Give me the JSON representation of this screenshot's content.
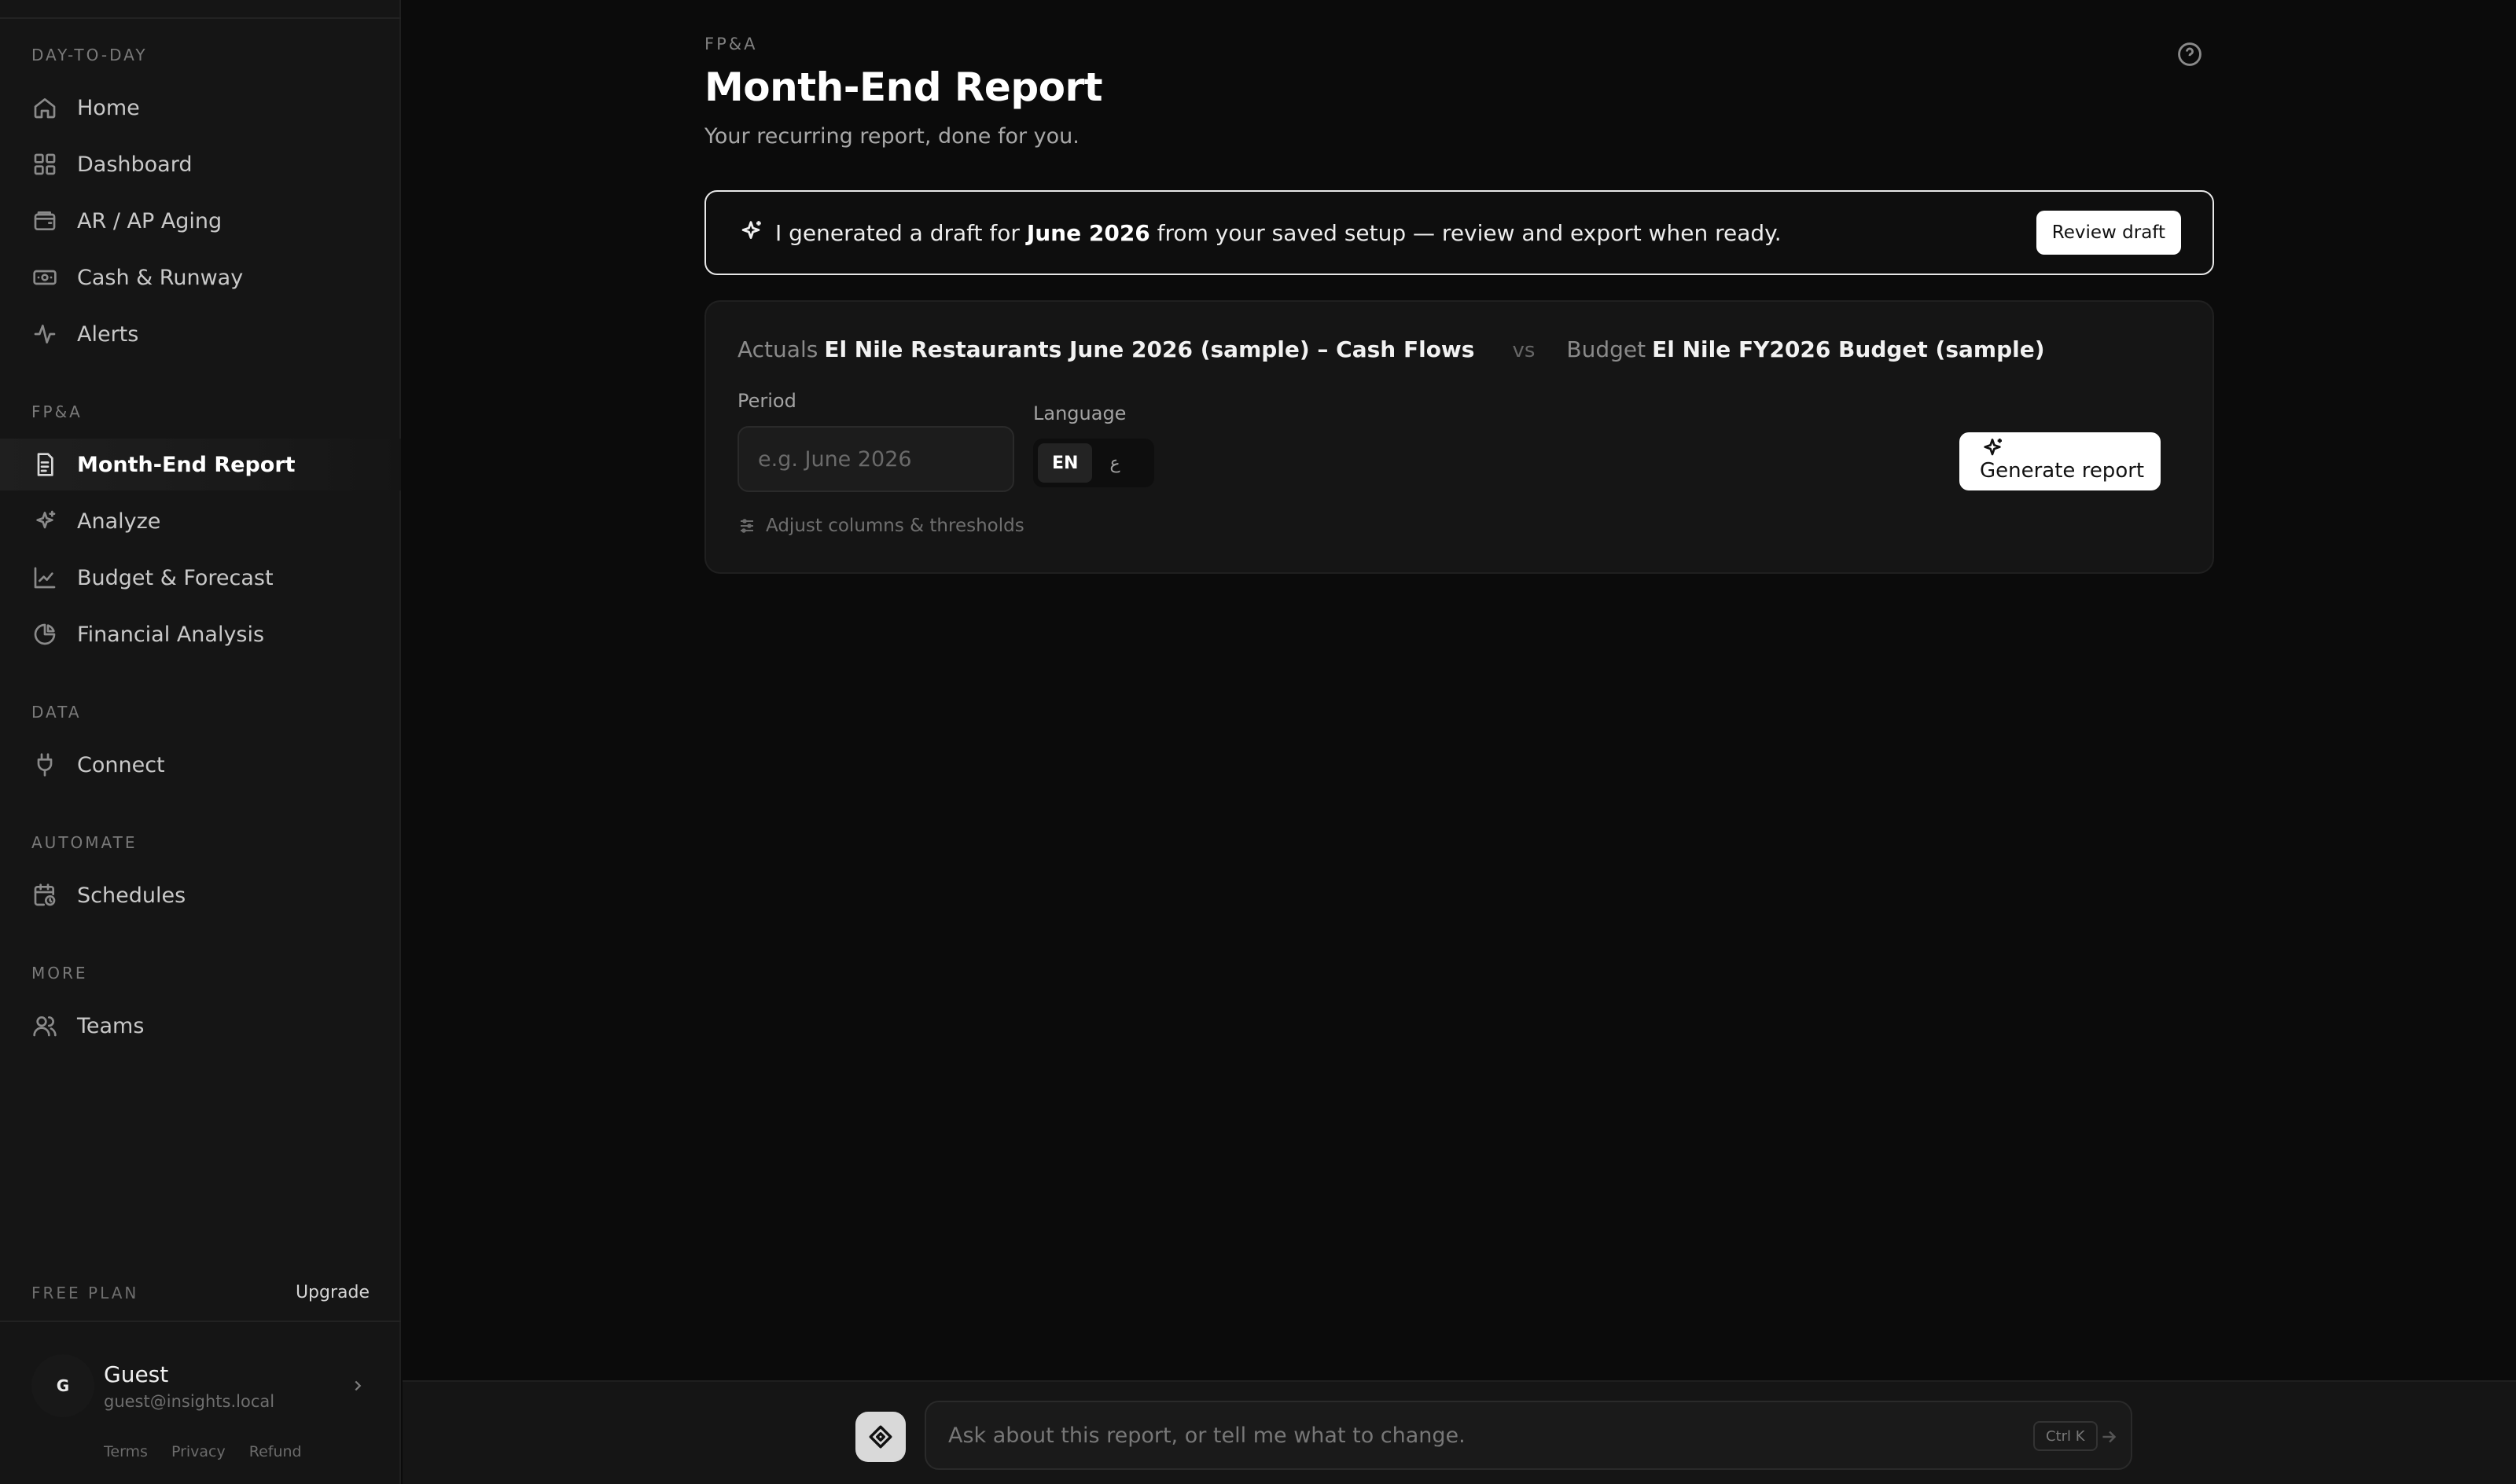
{
  "sidebar": {
    "sections": {
      "day_to_day": "DAY-TO-DAY",
      "fpa": "FP&A",
      "data": "DATA",
      "automate": "AUTOMATE",
      "more": "MORE"
    },
    "items": {
      "home": "Home",
      "dashboard": "Dashboard",
      "aging": "AR / AP Aging",
      "cash": "Cash & Runway",
      "alerts": "Alerts",
      "month_end": "Month-End Report",
      "analyze": "Analyze",
      "budget": "Budget & Forecast",
      "financial": "Financial Analysis",
      "connect": "Connect",
      "schedules": "Schedules",
      "teams": "Teams"
    },
    "plan_label": "FREE PLAN",
    "upgrade_label": "Upgrade",
    "user": {
      "initial": "G",
      "name": "Guest",
      "email": "guest@insights.local"
    },
    "footer": {
      "terms": "Terms",
      "privacy": "Privacy",
      "refund": "Refund"
    }
  },
  "header": {
    "eyebrow": "FP&A",
    "title": "Month-End Report",
    "subtitle": "Your recurring report, done for you."
  },
  "banner": {
    "text_before": "I generated a draft for ",
    "period": "June 2026",
    "text_after": " from your saved setup — review and export when ready.",
    "button_label": "Review draft"
  },
  "card": {
    "actuals_label": "Actuals",
    "actuals_value": "El Nile Restaurants June 2026 (sample) – Cash Flows",
    "vs_label": "vs",
    "budget_label": "Budget",
    "budget_value": "El Nile FY2026 Budget (sample)",
    "period_label": "Period",
    "period_placeholder": "e.g. June 2026",
    "period_value": "",
    "language_label": "Language",
    "language_options": [
      "EN",
      "ع"
    ],
    "language_selected": "EN",
    "adjust_label": "Adjust columns & thresholds",
    "generate_label": "Generate report"
  },
  "chat": {
    "placeholder": "Ask about this report, or tell me what to change.",
    "shortcut": "Ctrl K"
  },
  "colors": {
    "background": "#0b0b0b",
    "sidebar": "#151515",
    "accent": "#ffffff"
  }
}
